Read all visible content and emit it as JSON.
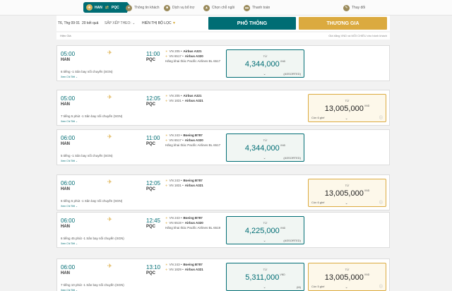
{
  "stepbar": {
    "route_from": "HAN",
    "route_to": "PQC",
    "steps": [
      {
        "label": "Thông tin khách",
        "icon": "passenger-icon"
      },
      {
        "label": "Dịch vụ bổ trợ",
        "icon": "services-icon"
      },
      {
        "label": "Chọn chỗ ngồi",
        "icon": "seat-icon"
      },
      {
        "label": "Thanh toán",
        "icon": "payment-icon"
      },
      {
        "label": "Thay đổi",
        "icon": "change-icon"
      }
    ]
  },
  "subbar": {
    "date": "T6, Thg 09 01",
    "results": "20 kết quả",
    "sort": "SẮP XẾP THEO:",
    "filter": "HIỂN THỊ BỘ LỌC",
    "tab_economy": "PHỔ THÔNG",
    "tab_business": "THƯƠNG GIA"
  },
  "infobar": {
    "left": "Hiện Giá",
    "right": "Giá bằng VND và MỖI CHIỀU cho hành khách"
  },
  "labels": {
    "from": "TỪ",
    "currency": "VND",
    "details": "Xem Chi Tiết"
  },
  "flights": [
    {
      "dep_time": "05:00",
      "dep_code": "HAN",
      "arr_time": "11:00",
      "arr_code": "PQC",
      "stops": "6 tiếng -1 Sân bay nối chuyến (SGN)",
      "segments": [
        {
          "flight": "VN 205",
          "aircraft": "Airbus A321"
        },
        {
          "flight": "VN 6517",
          "aircraft": "Airbus A320"
        }
      ],
      "operated": "Hãng khai thác Pacific Airlines BL 6517",
      "economy": {
        "price": "4,344,000",
        "note": "(ASSORTED)",
        "seats": ""
      },
      "business": null
    },
    {
      "dep_time": "05:00",
      "dep_code": "HAN",
      "arr_time": "12:05",
      "arr_code": "PQC",
      "stops": "7 tiếng 5 phút -1 Sân bay nối chuyến (SGN)",
      "segments": [
        {
          "flight": "VN 205",
          "aircraft": "Airbus A321"
        },
        {
          "flight": "VN 1831",
          "aircraft": "Airbus A321"
        }
      ],
      "operated": "",
      "economy": null,
      "business": {
        "price": "13,005,000",
        "note": "",
        "seats": "Còn 6 ghế"
      }
    },
    {
      "dep_time": "06:00",
      "dep_code": "HAN",
      "arr_time": "11:00",
      "arr_code": "PQC",
      "stops": "5 tiếng -1 Sân bay nối chuyến (SGN)",
      "segments": [
        {
          "flight": "VN 243",
          "aircraft": "Boeing B787"
        },
        {
          "flight": "VN 6517",
          "aircraft": "Airbus A320"
        }
      ],
      "operated": "Hãng khai thác Pacific Airlines BL 6517",
      "economy": {
        "price": "4,344,000",
        "note": "(ASSORTED)",
        "seats": ""
      },
      "business": null
    },
    {
      "dep_time": "06:00",
      "dep_code": "HAN",
      "arr_time": "12:05",
      "arr_code": "PQC",
      "stops": "6 tiếng 5 phút -1 Sân bay nối chuyến (SGN)",
      "segments": [
        {
          "flight": "VN 243",
          "aircraft": "Boeing B787"
        },
        {
          "flight": "VN 1831",
          "aircraft": "Airbus A321"
        }
      ],
      "operated": "",
      "economy": null,
      "business": {
        "price": "13,005,000",
        "note": "",
        "seats": "Còn 6 ghế"
      }
    },
    {
      "dep_time": "06:00",
      "dep_code": "HAN",
      "arr_time": "12:45",
      "arr_code": "PQC",
      "stops": "6 tiếng 45 phút -1 Sân bay nối chuyến (SGN)",
      "segments": [
        {
          "flight": "VN 243",
          "aircraft": "Boeing B787"
        },
        {
          "flight": "VN 6519",
          "aircraft": "Airbus A320"
        }
      ],
      "operated": "Hãng khai thác Pacific Airlines BL 6519",
      "economy": {
        "price": "4,225,000",
        "note": "(ASSORTED)",
        "seats": ""
      },
      "business": null
    },
    {
      "dep_time": "06:00",
      "dep_code": "HAN",
      "arr_time": "13:10",
      "arr_code": "PQC",
      "stops": "7 tiếng 10 phút -1 Sân bay nối chuyến (SGN)",
      "segments": [
        {
          "flight": "VN 243",
          "aircraft": "Boeing B787"
        },
        {
          "flight": "VN 1829",
          "aircraft": "Airbus A321"
        }
      ],
      "operated": "",
      "economy": {
        "price": "5,311,000",
        "note": "(M)",
        "seats": ""
      },
      "business": {
        "price": "13,005,000",
        "note": "",
        "seats": "Còn 5 ghế"
      }
    }
  ]
}
